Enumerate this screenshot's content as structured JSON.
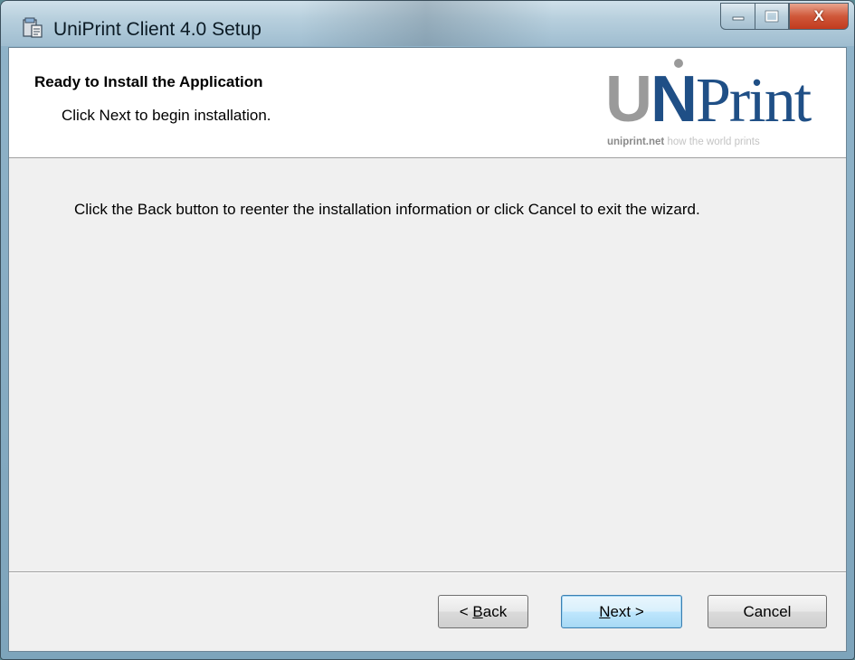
{
  "window": {
    "title": "UniPrint Client 4.0 Setup",
    "controls": {
      "minimize_icon": "minimize-icon",
      "maximize_icon": "maximize-icon",
      "close_icon": "close-icon",
      "close_glyph": "X"
    }
  },
  "banner": {
    "title": "Ready to Install the Application",
    "subtitle": "Click Next to begin installation.",
    "logo": {
      "letter_u": "U",
      "letter_n": "N",
      "word_rest": "Print",
      "site": "uniprint.net",
      "slogan": " how the world prints",
      "colors": {
        "blue": "#1f4f86",
        "gray": "#9a9a9a"
      }
    }
  },
  "body": {
    "message": "Click the Back button to reenter the installation information or click Cancel to exit the wizard."
  },
  "buttons": {
    "back": {
      "prefix": "< ",
      "accel": "B",
      "rest": "ack"
    },
    "next": {
      "accel": "N",
      "rest": "ext >"
    },
    "cancel": {
      "label": "Cancel"
    }
  },
  "colors": {
    "dialog_background": "#f0f0f0",
    "banner_background": "#ffffff",
    "default_button_border": "#3c7fb1"
  }
}
